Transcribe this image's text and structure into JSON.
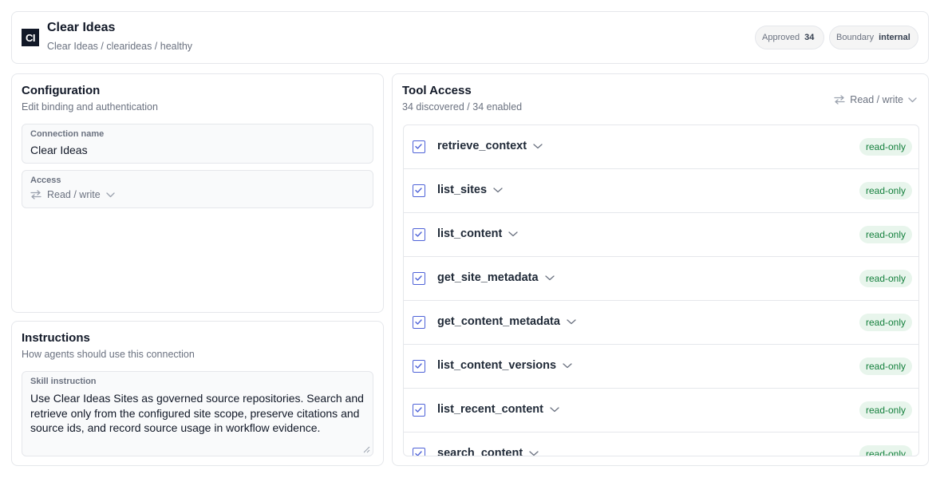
{
  "header": {
    "logo": "CI",
    "title": "Clear Ideas",
    "breadcrumb": "Clear Ideas / clearideas / healthy",
    "approved_label": "Approved",
    "approved_count": "34",
    "boundary_label": "Boundary",
    "boundary_value": "internal"
  },
  "config": {
    "title": "Configuration",
    "subtitle": "Edit binding and authentication",
    "conn_label": "Connection name",
    "conn_value": "Clear Ideas",
    "access_label": "Access",
    "access_value": "Read / write"
  },
  "instructions": {
    "title": "Instructions",
    "subtitle": "How agents should use this connection",
    "skill_label": "Skill instruction",
    "skill_value": "Use Clear Ideas Sites as governed source repositories. Search and retrieve only from the configured site scope, preserve citations and source ids, and record source usage in workflow evidence."
  },
  "tools": {
    "title": "Tool Access",
    "subtitle": "34 discovered / 34 enabled",
    "mode": "Read / write",
    "items": [
      {
        "name": "retrieve_context",
        "badge": "read-only"
      },
      {
        "name": "list_sites",
        "badge": "read-only"
      },
      {
        "name": "list_content",
        "badge": "read-only"
      },
      {
        "name": "get_site_metadata",
        "badge": "read-only"
      },
      {
        "name": "get_content_metadata",
        "badge": "read-only"
      },
      {
        "name": "list_content_versions",
        "badge": "read-only"
      },
      {
        "name": "list_recent_content",
        "badge": "read-only"
      },
      {
        "name": "search_content",
        "badge": "read-only"
      }
    ]
  },
  "colors": {
    "accent": "#4f63d8",
    "badge_bg": "#e8f5ec",
    "badge_text": "#15803d"
  }
}
